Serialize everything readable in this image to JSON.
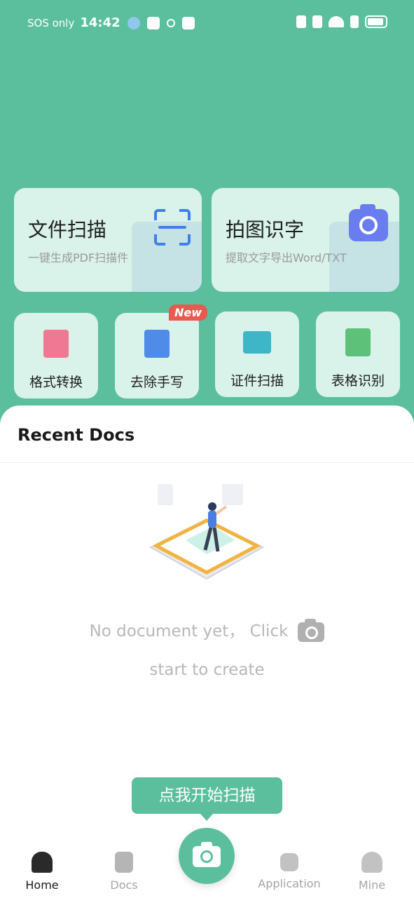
{
  "status_bar": {
    "carrier": "SOS only",
    "time": "14:42"
  },
  "feature_cards": [
    {
      "title": "文件扫描",
      "subtitle": "一键生成PDF扫描件",
      "icon": "scan-frame-icon"
    },
    {
      "title": "拍图识字",
      "subtitle": "提取文字导出Word/TXT",
      "icon": "camera-icon"
    }
  ],
  "tools": [
    {
      "label": "格式转换",
      "icon": "format-convert-icon",
      "color": "#f07892"
    },
    {
      "label": "去除手写",
      "icon": "remove-handwriting-icon",
      "color": "#4f8be8",
      "badge": "New"
    },
    {
      "label": "证件扫描",
      "icon": "id-card-icon",
      "color": "#3eb6c8"
    },
    {
      "label": "表格识别",
      "icon": "spreadsheet-icon",
      "color": "#5dc17a"
    }
  ],
  "recent": {
    "heading": "Recent Docs",
    "empty_line1": "No document yet， Click",
    "empty_line2": "start to create"
  },
  "tooltip": "点我开始扫描",
  "nav": [
    {
      "label": "Home",
      "icon": "home-icon",
      "active": true
    },
    {
      "label": "Docs",
      "icon": "docs-icon",
      "active": false
    },
    {
      "label": "Application",
      "icon": "application-icon",
      "active": false
    },
    {
      "label": "Mine",
      "icon": "profile-icon",
      "active": false
    }
  ],
  "colors": {
    "accent": "#5bbf9e",
    "card_bg": "#d9f2ea",
    "badge": "#e65a4f"
  }
}
